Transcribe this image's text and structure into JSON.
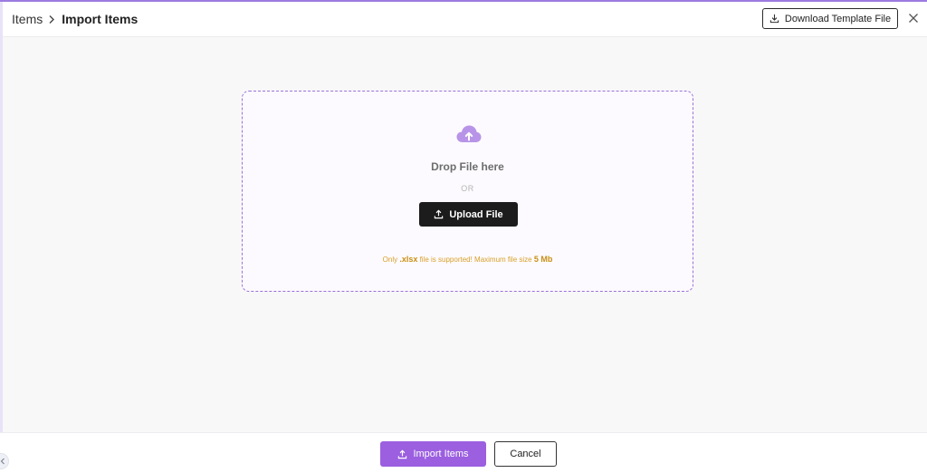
{
  "breadcrumb": {
    "parent": "Items",
    "current": "Import Items"
  },
  "header": {
    "download_label": "Download Template File"
  },
  "dropzone": {
    "drop_text": "Drop File here",
    "or_text": "OR",
    "upload_label": "Upload File",
    "support": {
      "prefix": "Only ",
      "ext": ".xlsx",
      "middle": " file is supported! Maximum file size ",
      "size": "5 Mb"
    }
  },
  "footer": {
    "import_label": "Import Items",
    "cancel_label": "Cancel"
  },
  "icons": {
    "chevron": "chevron-right-icon",
    "download": "download-icon",
    "close": "close-icon",
    "cloud": "cloud-upload-icon",
    "upload": "upload-icon",
    "collapse": "chevron-left-icon"
  },
  "colors": {
    "accent": "#9b5fe0",
    "dashed_border": "#9a72d8",
    "cloud_icon": "#b894e8",
    "upload_button": "#1c1c1c",
    "support_text": "#d8a02a"
  }
}
